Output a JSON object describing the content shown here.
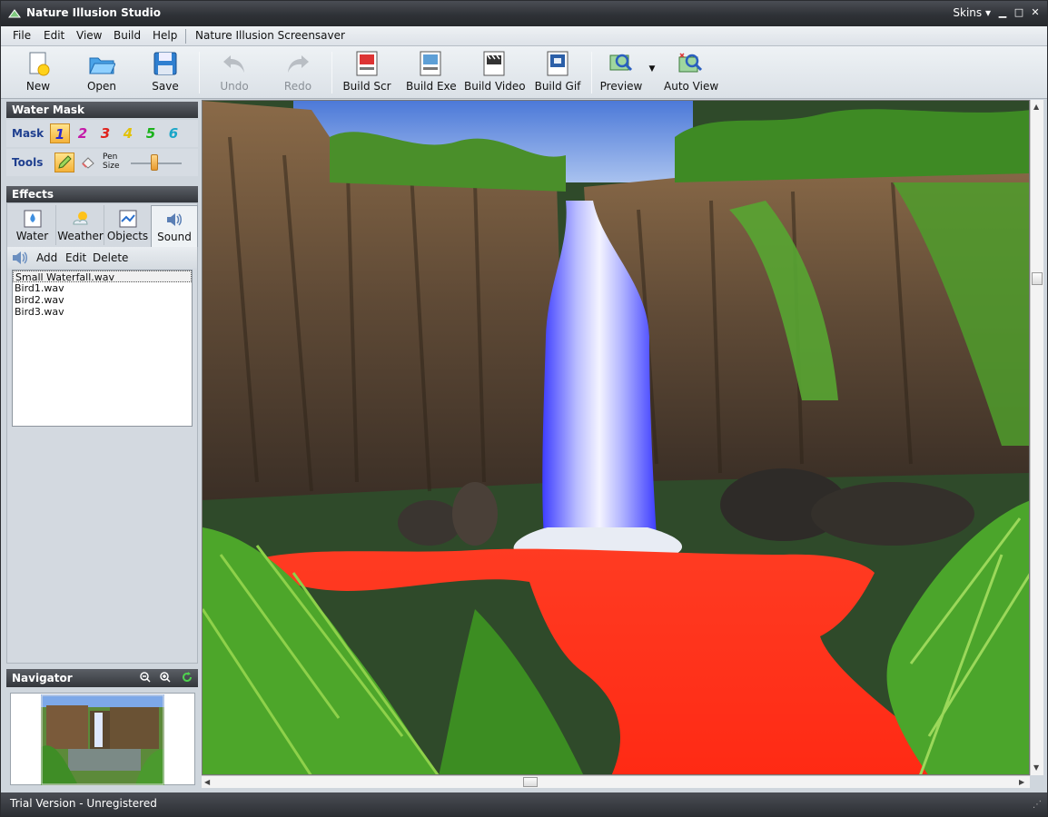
{
  "window": {
    "title": "Nature Illusion Studio",
    "skins_label": "Skins",
    "min": "▾",
    "max": "□",
    "close": "✕"
  },
  "menu": {
    "items": [
      "File",
      "Edit",
      "View",
      "Build",
      "Help"
    ],
    "extra": "Nature Illusion Screensaver"
  },
  "toolbar": {
    "new": "New",
    "open": "Open",
    "save": "Save",
    "undo": "Undo",
    "redo": "Redo",
    "build_scr": "Build Scr",
    "build_exe": "Build Exe",
    "build_video": "Build Video",
    "build_gif": "Build Gif",
    "preview": "Preview",
    "auto_view": "Auto View"
  },
  "water_mask": {
    "title": "Water Mask",
    "mask_label": "Mask",
    "masks": [
      "1",
      "2",
      "3",
      "4",
      "5",
      "6"
    ],
    "mask_colors": [
      "#2a2ad0",
      "#c41aa8",
      "#e0221c",
      "#e2c20a",
      "#1bb21b",
      "#1aa6c8"
    ],
    "tools_label": "Tools",
    "pen_size_label": "Pen Size"
  },
  "effects": {
    "title": "Effects",
    "tabs": [
      "Water",
      "Weather",
      "Objects",
      "Sound"
    ],
    "active_tab": "Sound",
    "sound_tools": {
      "add": "Add",
      "edit": "Edit",
      "delete": "Delete"
    },
    "sounds": [
      "Small Waterfall.wav",
      "Bird1.wav",
      "Bird2.wav",
      "Bird3.wav"
    ]
  },
  "navigator": {
    "title": "Navigator"
  },
  "status": {
    "text": "Trial Version - Unregistered"
  },
  "colors": {
    "accent": "#f4b23a",
    "header": "#33363b",
    "water_mask_red": "#ff2a1a",
    "water_mask_blue": "#4a4aff"
  }
}
